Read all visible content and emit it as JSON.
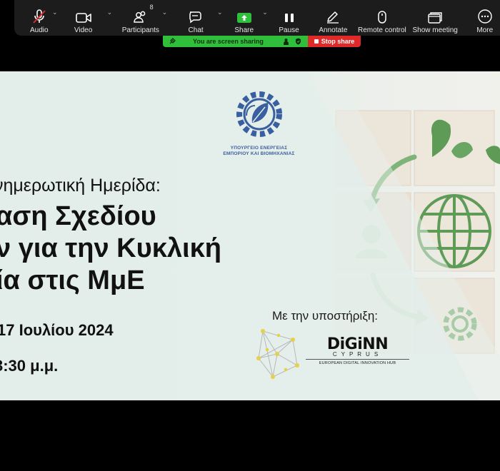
{
  "toolbar": {
    "audio": "Audio",
    "video": "Video",
    "participants": "Participants",
    "participants_count": "8",
    "chat": "Chat",
    "share": "Share",
    "pause": "Pause",
    "annotate": "Annotate",
    "remote_control": "Remote control",
    "show_meeting": "Show meeting",
    "more": "More"
  },
  "share_bar": {
    "status": "You are screen sharing",
    "stop": "Stop share"
  },
  "slide": {
    "ministry_name_line1": "ΥΠΟΥΡΓΕΙΟ ΕΝΕΡΓΕΙΑΣ",
    "ministry_name_line2": "ΕΜΠΟΡΙΟΥ ΚΑΙ ΒΙΟΜΗΧΑΝΙΑΣ",
    "event_type": "νημερωτική Ημερίδα:",
    "title_line1": "αση Σχεδίου",
    "title_line2": "ν για την Κυκλική",
    "title_line3": "ία στις ΜμΕ",
    "date": "17 Ιουλίου 2024",
    "time": "3:30 μ.μ.",
    "support_label": "Με την υποστήριξη:",
    "partner_name": "DiGiNN",
    "partner_sub": "CYPRUS",
    "partner_hub": "EUROPEAN DIGITAL INNOVATION HUB"
  },
  "colors": {
    "toolbar_bg": "#1c1c1c",
    "share_green": "#2fbf3b",
    "stop_red": "#e02a2a",
    "slide_bg": "#e3eee9",
    "ministry_blue": "#3a5fa0",
    "leaf_green": "#5e9b57"
  },
  "icons": [
    "mic-muted-icon",
    "video-camera-icon",
    "participants-icon",
    "chat-icon",
    "share-arrow-icon",
    "pause-icon",
    "pen-icon",
    "mouse-icon",
    "window-icon",
    "more-dots-icon"
  ]
}
